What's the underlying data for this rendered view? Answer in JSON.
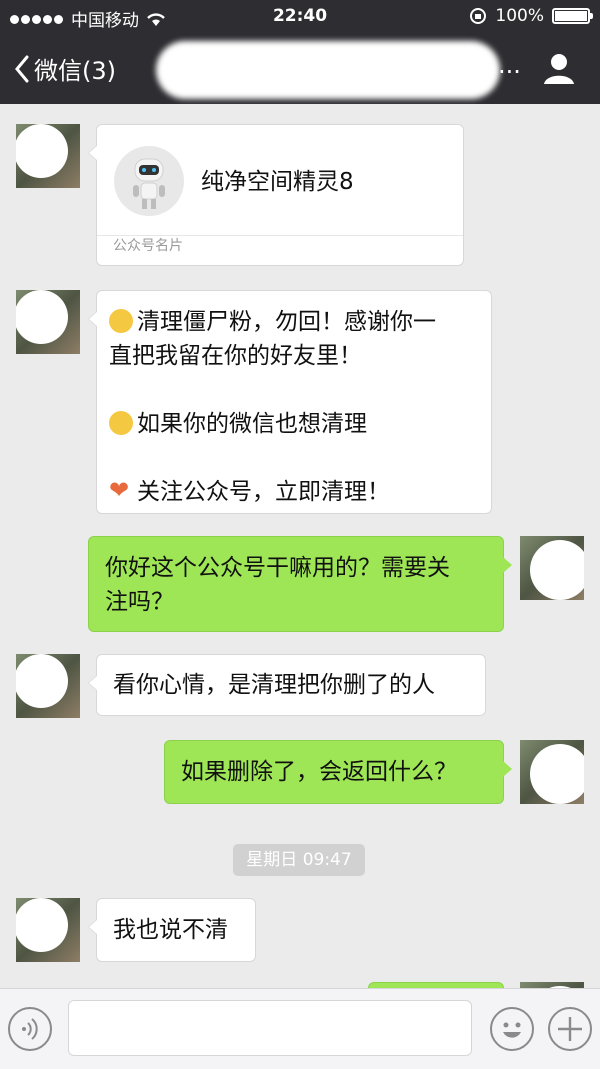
{
  "status_bar": {
    "carrier": "中国移动",
    "time": "22:40",
    "battery": "100%"
  },
  "nav": {
    "back_label": "微信(3)",
    "title_suffix": "..."
  },
  "messages": [
    {
      "type": "card",
      "sender": "other",
      "name": "纯净空间精灵8",
      "card_label": "公众号名片"
    },
    {
      "type": "text",
      "sender": "other",
      "lines": [
        "清理僵尸粉，勿回！感谢你一",
        "直把我留在你的好友里！",
        "",
        "如果你的微信也想清理",
        "",
        "关注公众号，立即清理！"
      ]
    },
    {
      "type": "text",
      "sender": "me",
      "lines": [
        "你好这个公众号干嘛用的？需要关",
        "注吗？"
      ]
    },
    {
      "type": "text",
      "sender": "other",
      "lines": [
        "看你心情，是清理把你删了的人"
      ]
    },
    {
      "type": "text",
      "sender": "me",
      "lines": [
        "如果删除了，会返回什么？"
      ]
    },
    {
      "type": "timestamp",
      "text": "星期日 09:47"
    },
    {
      "type": "text",
      "sender": "other",
      "lines": [
        "我也说不清"
      ]
    }
  ],
  "icons": {
    "back": "chevron-left-icon",
    "profile": "person-icon",
    "voice": "voice-icon",
    "emoji": "emoji-icon",
    "add": "plus-icon"
  },
  "colors": {
    "my_bubble": "#9ee655",
    "other_bubble": "#ffffff",
    "header": "#2e2e32",
    "background": "#ebebeb"
  }
}
